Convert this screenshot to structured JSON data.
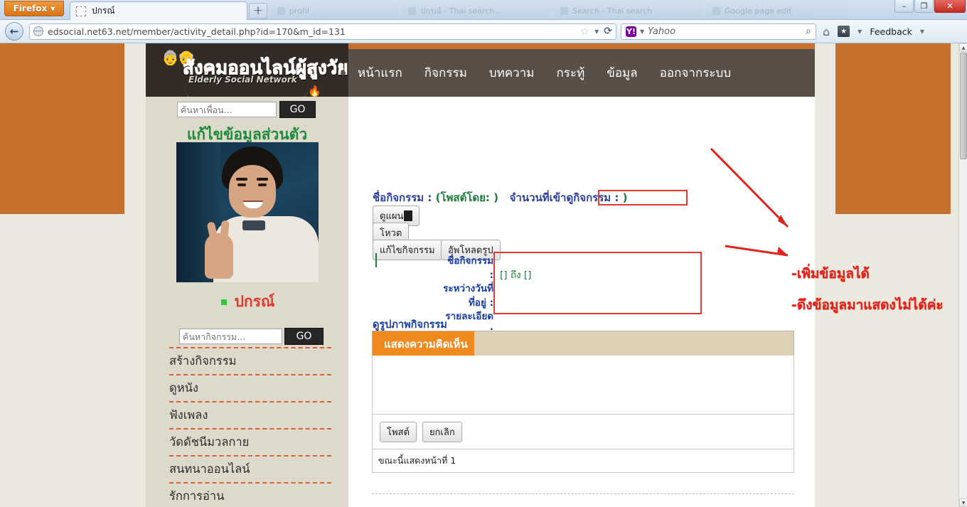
{
  "browser": {
    "app_button": "Firefox",
    "tab_title": "ปกรณ์",
    "new_tab_label": "+",
    "ghost_tabs": [
      "profil",
      "ปกรณ์ - Thai search...",
      "Search - Thai search",
      "Google page edit"
    ],
    "url": "edsocial.net63.net/member/activity_detail.php?id=170&m_id=131",
    "url_host_bold": "net63.net",
    "search_engine": "Yahoo",
    "search_placeholder": "Yahoo",
    "feedback_label": "Feedback",
    "icons": {
      "back": "back-arrow-icon",
      "globe": "globe-icon",
      "star": "bookmark-star-icon",
      "reload": "reload-icon",
      "magnifier": "search-magnifier-icon",
      "home": "home-icon",
      "bookmarks": "bookmarks-icon"
    },
    "window_controls": {
      "minimize": "–",
      "maximize": "❐",
      "close": "✕"
    }
  },
  "site": {
    "logo_title": "สังคมออนไลน์ผู้สูงวัย",
    "logo_subtitle": "Elderly Social Network",
    "nav": [
      {
        "label": "หน้าแรก"
      },
      {
        "label": "กิจกรรม"
      },
      {
        "label": "บทความ"
      },
      {
        "label": "กระทู้"
      },
      {
        "label": "ข้อมูล"
      },
      {
        "label": "ออกจากระบบ"
      }
    ]
  },
  "sidebar": {
    "friend_search_placeholder": "ค้นหาเพื่อน...",
    "friend_search_value": "",
    "go_label": "GO",
    "edit_profile_heading": "แก้ไขข้อมูลส่วนตัว",
    "username": "ปกรณ์",
    "status": "online",
    "activity_search_placeholder": "ค้นหากิจกรรม...",
    "activity_search_value": "",
    "go_label2": "GO",
    "links": [
      {
        "label": "สร้างกิจกรรม"
      },
      {
        "label": "ดูหนัง"
      },
      {
        "label": "ฟังเพลง"
      },
      {
        "label": "วัดดัชนีมวลกาย"
      },
      {
        "label": "สนทนาออนไลน์"
      },
      {
        "label": "รักการอ่าน"
      }
    ]
  },
  "main": {
    "title_label": "ชื่อกิจกรรม :",
    "posted_by": "(โพสต์โดย: )",
    "views_label": "จำนวนที่เข้าดูกิจกรรม :",
    "views_value": ")",
    "buttons": {
      "plan": "ดูแผน",
      "vote": "โหวต",
      "edit": "แก้ไขกิจกรรม",
      "upload": "อัพโหลดรูป"
    },
    "detail_labels": {
      "name": "ชื่อกิจกรรม :",
      "dates": "ระหว่างวันที่",
      "address": "ที่อยู่ :",
      "description": "รายละเอียด :"
    },
    "detail_values": {
      "name": "",
      "dates": "[] ถึง []",
      "address": "",
      "description": ""
    },
    "photos_link": "ดูรูปภาพกิจกรรม",
    "comment_tab": "แสดงความคิดเห็น",
    "comment_value": "",
    "post_button": "โพสต์",
    "cancel_button": "ยกเลิก",
    "page_status": "ขณะนี้แสดงหน้าที่ 1"
  },
  "annotations": [
    {
      "text": "-เพิ่มข้อมูลได้"
    },
    {
      "text": "-ดึงข้อมูลมาแสดงไม่ได้ค่ะ"
    }
  ],
  "colors": {
    "accent_orange": "#c6702e",
    "nav_brown": "#5a4f47",
    "header_dark": "#332b26",
    "sidebar_bg": "#ddd9cb",
    "annotation_red": "#e0241b",
    "tab_orange": "#f08a1e",
    "heading_green": "#1f8a3b",
    "username_red": "#e13a2b"
  }
}
